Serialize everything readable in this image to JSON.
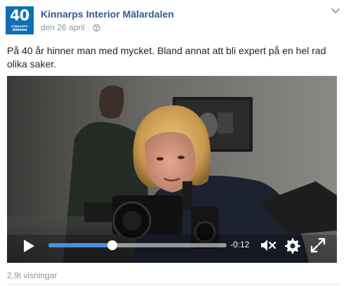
{
  "post": {
    "page_name": "Kinnarps Interior Mälardalen",
    "date": "den 26 april",
    "separator": "·",
    "privacy_icon": "globe-icon",
    "menu_icon": "chevron-down-icon",
    "text": "På 40 år hinner man med mycket. Bland annat att bli expert på en hel rad olika saker.",
    "avatar": {
      "number": "40",
      "number_suffix": "år",
      "brand_line_1": "KINNARPS INTERIOR",
      "brand_line_2": "Mälardalen",
      "background": "#0f6fb3"
    }
  },
  "video": {
    "play_icon": "play-icon",
    "progress": 0.36,
    "time_remaining": "-0:12",
    "mute_icon": "volume-muted-icon",
    "settings_icon": "gear-icon",
    "fullscreen_icon": "fullscreen-icon",
    "accent": "#4a90e2"
  },
  "footer": {
    "views": "2,9t visningar"
  },
  "colors": {
    "link": "#365899",
    "meta": "#90949c",
    "text": "#1d2129"
  }
}
